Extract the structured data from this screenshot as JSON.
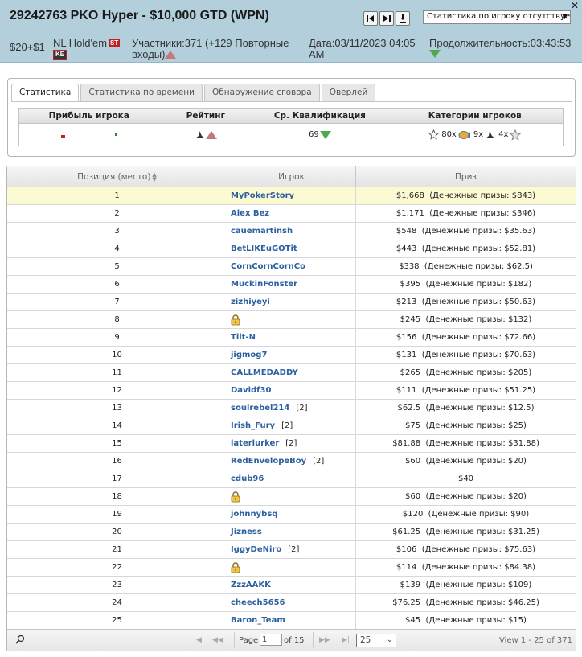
{
  "header": {
    "title": "29242763 PKO Hyper - $10,000 GTD (WPN)",
    "stat_select": "Статистика по игроку отсутствует",
    "buyin": "$20+$1",
    "game": "NL Hold'em",
    "badge_st": "ST",
    "badge_ke": "KE",
    "participants_line1": "Участники:371 (+129 Повторные",
    "participants_line2": "входы)",
    "date_line1": "Дата:03/11/2023 04:05",
    "date_line2": "AM",
    "duration": "Продолжительность:03:43:53",
    "colors": {
      "header_bg": "#b4cfdc",
      "up": "#c47a7a",
      "down": "#4faa4f"
    }
  },
  "tabs": [
    {
      "label": "Статистика",
      "active": true
    },
    {
      "label": "Статистика по времени",
      "active": false
    },
    {
      "label": "Обнаружение сговора",
      "active": false
    },
    {
      "label": "Оверлей",
      "active": false
    }
  ],
  "stats": {
    "headers": [
      "Прибыль игрока",
      "Рейтинг",
      "Ср. Квалификация",
      "Категории игроков"
    ],
    "avg_qualification": "69",
    "categories": [
      {
        "icon": "star-outline-icon",
        "count": "80x"
      },
      {
        "icon": "fish-icon",
        "count": "9x"
      },
      {
        "icon": "shark-icon",
        "count": "4x"
      }
    ]
  },
  "table": {
    "columns": [
      "Позиция (место)",
      "Игрок",
      "Приз"
    ],
    "rows": [
      {
        "pos": "1",
        "player": "MyPokerStory",
        "reentry": "",
        "locked": false,
        "prize": "$1,668  (Денежные призы: $843)"
      },
      {
        "pos": "2",
        "player": "Alex Bez",
        "reentry": "",
        "locked": false,
        "prize": "$1,171  (Денежные призы: $346)"
      },
      {
        "pos": "3",
        "player": "cauemartinsh",
        "reentry": "",
        "locked": false,
        "prize": "$548  (Денежные призы: $35.63)"
      },
      {
        "pos": "4",
        "player": "BetLIKEuGOTit",
        "reentry": "",
        "locked": false,
        "prize": "$443  (Денежные призы: $52.81)"
      },
      {
        "pos": "5",
        "player": "CornCornCornCo",
        "reentry": "",
        "locked": false,
        "prize": "$338  (Денежные призы: $62.5)"
      },
      {
        "pos": "6",
        "player": "MuckinFonster",
        "reentry": "",
        "locked": false,
        "prize": "$395  (Денежные призы: $182)"
      },
      {
        "pos": "7",
        "player": "zizhiyeyi",
        "reentry": "",
        "locked": false,
        "prize": "$213  (Денежные призы: $50.63)"
      },
      {
        "pos": "8",
        "player": "",
        "reentry": "",
        "locked": true,
        "prize": "$245  (Денежные призы: $132)"
      },
      {
        "pos": "9",
        "player": "Tilt-N",
        "reentry": "",
        "locked": false,
        "prize": "$156  (Денежные призы: $72.66)"
      },
      {
        "pos": "10",
        "player": "jigmog7",
        "reentry": "",
        "locked": false,
        "prize": "$131  (Денежные призы: $70.63)"
      },
      {
        "pos": "11",
        "player": "CALLMEDADDY",
        "reentry": "",
        "locked": false,
        "prize": "$265  (Денежные призы: $205)"
      },
      {
        "pos": "12",
        "player": "Davidf30",
        "reentry": "",
        "locked": false,
        "prize": "$111  (Денежные призы: $51.25)"
      },
      {
        "pos": "13",
        "player": "soulrebel214",
        "reentry": "[2]",
        "locked": false,
        "prize": "$62.5  (Денежные призы: $12.5)"
      },
      {
        "pos": "14",
        "player": "Irish_Fury",
        "reentry": "[2]",
        "locked": false,
        "prize": "$75  (Денежные призы: $25)"
      },
      {
        "pos": "15",
        "player": "laterlurker",
        "reentry": "[2]",
        "locked": false,
        "prize": "$81.88  (Денежные призы: $31.88)"
      },
      {
        "pos": "16",
        "player": "RedEnvelopeBoy",
        "reentry": "[2]",
        "locked": false,
        "prize": "$60  (Денежные призы: $20)"
      },
      {
        "pos": "17",
        "player": "cdub96",
        "reentry": "",
        "locked": false,
        "prize": "$40"
      },
      {
        "pos": "18",
        "player": "",
        "reentry": "",
        "locked": true,
        "prize": "$60  (Денежные призы: $20)"
      },
      {
        "pos": "19",
        "player": "johnnybsq",
        "reentry": "",
        "locked": false,
        "prize": "$120  (Денежные призы: $90)"
      },
      {
        "pos": "20",
        "player": "Jizness",
        "reentry": "",
        "locked": false,
        "prize": "$61.25  (Денежные призы: $31.25)"
      },
      {
        "pos": "21",
        "player": "IggyDeNiro",
        "reentry": "[2]",
        "locked": false,
        "prize": "$106  (Денежные призы: $75.63)"
      },
      {
        "pos": "22",
        "player": "",
        "reentry": "",
        "locked": true,
        "prize": "$114  (Денежные призы: $84.38)"
      },
      {
        "pos": "23",
        "player": "ZzzAAKK",
        "reentry": "",
        "locked": false,
        "prize": "$139  (Денежные призы: $109)"
      },
      {
        "pos": "24",
        "player": "cheech5656",
        "reentry": "",
        "locked": false,
        "prize": "$76.25  (Денежные призы: $46.25)"
      },
      {
        "pos": "25",
        "player": "Baron_Team",
        "reentry": "",
        "locked": false,
        "prize": "$45  (Денежные призы: $15)"
      }
    ]
  },
  "pager": {
    "page_label": "Page",
    "page_value": "1",
    "of_label": "of 15",
    "rows_per_page": "25",
    "view": "View 1 - 25 of 371"
  }
}
